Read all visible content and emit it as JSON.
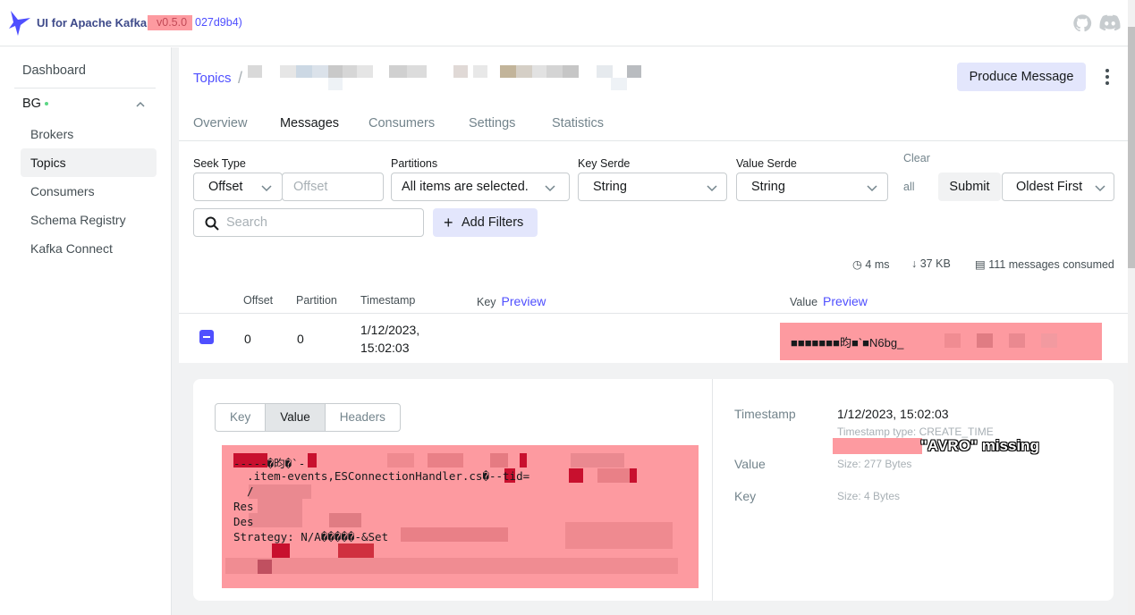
{
  "app": {
    "title": "UI for Apache Kafka",
    "version": "v0.5.0",
    "commit": "027d9b4)"
  },
  "sidebar": {
    "dashboard": "Dashboard",
    "cluster": "BG",
    "items": [
      "Brokers",
      "Topics",
      "Consumers",
      "Schema Registry",
      "Kafka Connect"
    ],
    "active": "Topics"
  },
  "breadcrumb": {
    "root": "Topics",
    "separator": "/"
  },
  "actions": {
    "produce": "Produce Message"
  },
  "tabs": [
    "Overview",
    "Messages",
    "Consumers",
    "Settings",
    "Statistics"
  ],
  "filters": {
    "seek_type_label": "Seek Type",
    "seek_type_value": "Offset",
    "offset_placeholder": "Offset",
    "partitions_label": "Partitions",
    "partitions_value": "All items are selected.",
    "key_serde_label": "Key Serde",
    "key_serde_value": "String",
    "value_serde_label": "Value Serde",
    "value_serde_value": "String",
    "clear_label": "Clear",
    "clear_all": "all",
    "submit": "Submit",
    "order_value": "Oldest First",
    "search_placeholder": "Search",
    "add_filters": "Add Filters"
  },
  "stats": {
    "elapsed": "4 ms",
    "bytes": "37 KB",
    "consumed": "111 messages consumed"
  },
  "table": {
    "headers": {
      "offset": "Offset",
      "partition": "Partition",
      "timestamp": "Timestamp",
      "key": "Key",
      "value": "Value",
      "preview": "Preview"
    },
    "row": {
      "offset": "0",
      "partition": "0",
      "timestamp_date": "1/12/2023,",
      "timestamp_time": "15:02:03",
      "value": "■■■■■■■昀■`■N6bg_"
    }
  },
  "detail": {
    "tabs": [
      "Key",
      "Value",
      "Headers"
    ],
    "active_tab": "Value",
    "code_lines": [
      "-----�昀�`-",
      "  .item-events,ESConnectionHandler.cs�--tid=",
      "  /",
      "Res",
      "Des",
      "Strategy: N/A�����-&Set"
    ],
    "timestamp_label": "Timestamp",
    "timestamp_value": "1/12/2023, 15:02:03",
    "timestamp_type": "Timestamp type: CREATE_TIME",
    "avro_note": "\"AVRO\" missing",
    "value_label": "Value",
    "value_size": "Size: 277 Bytes",
    "key_label": "Key",
    "key_size": "Size: 4 Bytes"
  },
  "colors": {
    "accent": "#4f4fff",
    "redaction": "#fd9aa0",
    "muted": "#73848c"
  }
}
